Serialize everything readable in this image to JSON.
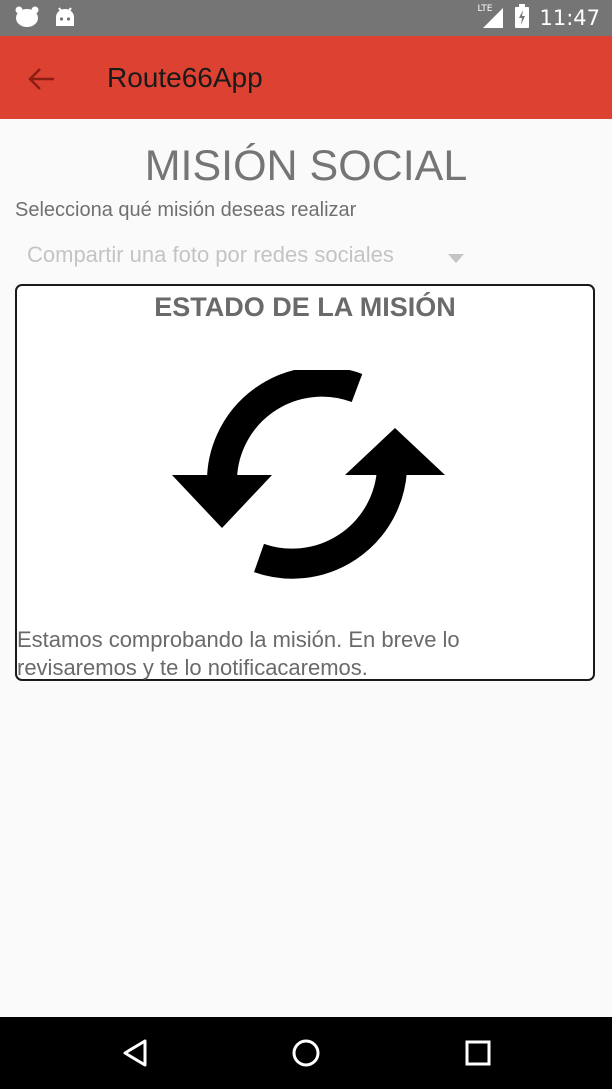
{
  "status_bar": {
    "time": "11:47",
    "network": "LTE",
    "icons": [
      "android-notification-icon",
      "android-notification-icon",
      "lte-signal-icon",
      "battery-charging-icon"
    ]
  },
  "app_bar": {
    "title": "Route66App",
    "back_icon": "back-arrow-icon",
    "color": "#dd4132"
  },
  "main": {
    "title": "MISIÓN SOCIAL",
    "select_label": "Selecciona qué misión deseas realizar",
    "dropdown": {
      "selected": "Compartir una foto por redes sociales",
      "icon": "dropdown-caret-icon"
    }
  },
  "status_card": {
    "title": "ESTADO DE LA MISIÓN",
    "icon": "sync-icon",
    "message": "Estamos comprobando la misión. En breve lo revisaremos y te lo notificacaremos."
  },
  "nav_bar": {
    "buttons": [
      "back-triangle-icon",
      "home-circle-icon",
      "recents-square-icon"
    ]
  }
}
